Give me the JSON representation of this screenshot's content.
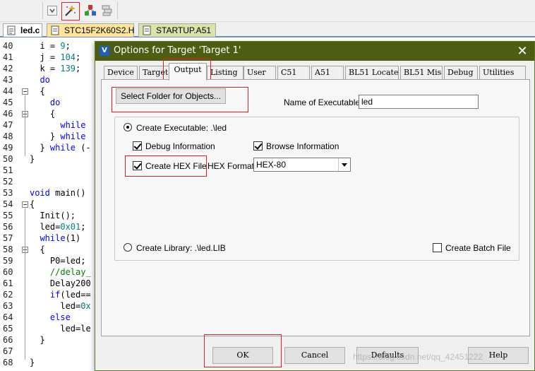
{
  "toolbar": {
    "icons": [
      "dropdown-arrow-icon",
      "magic-wand-icon",
      "components-icon",
      "stack-icon"
    ]
  },
  "tabs": [
    {
      "label": "led.c",
      "active": true
    },
    {
      "label": "STC15F2K60S2.H",
      "active": false
    },
    {
      "label": "STARTUP.A51",
      "active": false
    }
  ],
  "editor": {
    "lines": [
      {
        "num": "40",
        "text": "  i = 9;"
      },
      {
        "num": "41",
        "text": "  j = 104;"
      },
      {
        "num": "42",
        "text": "  k = 139;"
      },
      {
        "num": "43",
        "text": "  do"
      },
      {
        "num": "44",
        "text": "  {"
      },
      {
        "num": "45",
        "text": "    do"
      },
      {
        "num": "46",
        "text": "    {"
      },
      {
        "num": "47",
        "text": "      while"
      },
      {
        "num": "48",
        "text": "    } while"
      },
      {
        "num": "49",
        "text": "  } while (-"
      },
      {
        "num": "50",
        "text": "}"
      },
      {
        "num": "51",
        "text": ""
      },
      {
        "num": "52",
        "text": ""
      },
      {
        "num": "53",
        "text": "void main()"
      },
      {
        "num": "54",
        "text": "{"
      },
      {
        "num": "55",
        "text": "  Init();"
      },
      {
        "num": "56",
        "text": "  led=0x01;"
      },
      {
        "num": "57",
        "text": "  while(1)"
      },
      {
        "num": "58",
        "text": "  {"
      },
      {
        "num": "59",
        "text": "    P0=led;"
      },
      {
        "num": "60",
        "text": "    //delay_"
      },
      {
        "num": "61",
        "text": "    Delay200"
      },
      {
        "num": "62",
        "text": "    if(led=="
      },
      {
        "num": "63",
        "text": "      led=0x"
      },
      {
        "num": "64",
        "text": "    else"
      },
      {
        "num": "65",
        "text": "      led=le"
      },
      {
        "num": "66",
        "text": "  }"
      },
      {
        "num": "67",
        "text": ""
      },
      {
        "num": "68",
        "text": "}"
      }
    ]
  },
  "dialog": {
    "title": "Options for Target 'Target 1'",
    "close_label": "✕",
    "tabs": [
      "Device",
      "Target",
      "Output",
      "Listing",
      "User",
      "C51",
      "A51",
      "BL51 Locate",
      "BL51 Misc",
      "Debug",
      "Utilities"
    ],
    "active_tab": "Output",
    "select_folder_label": "Select Folder for Objects...",
    "name_exe_label": "Name of Executable:",
    "name_exe_value": "led",
    "create_exe_label": "Create Executable:  .\\led",
    "debug_info_label": "Debug Information",
    "browse_info_label": "Browse Information",
    "create_hex_label": "Create HEX File",
    "hex_format_label": "HEX Format:",
    "hex_format_value": "HEX-80",
    "create_lib_label": "Create Library:  .\\led.LIB",
    "create_batch_label": "Create Batch File",
    "ok_label": "OK",
    "cancel_label": "Cancel",
    "defaults_label": "Defaults",
    "help_label": "Help",
    "watermark": "https://blog.csdn.net/qq_42451222"
  }
}
